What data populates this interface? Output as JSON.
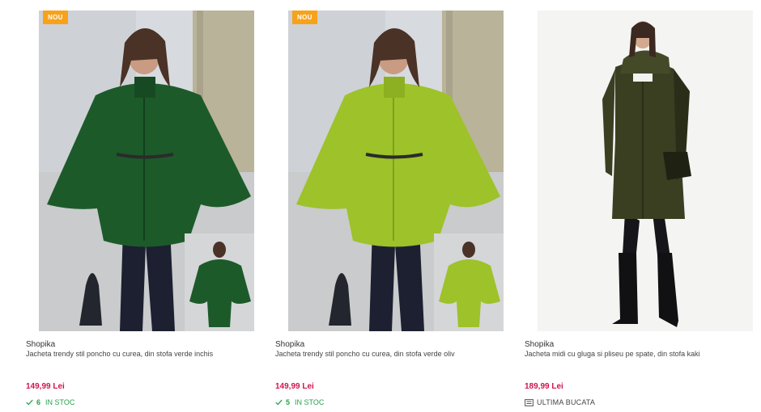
{
  "products": [
    {
      "badge": "NOU",
      "brand": "Shopika",
      "title": "Jacheta trendy stil poncho cu curea, din stofa verde inchis",
      "price": "149,99 Lei",
      "stock_count": "6",
      "stock_label": "IN STOC",
      "coat_color": "#1d5a2a",
      "coat_color_dark": "#123f1c"
    },
    {
      "badge": "NOU",
      "brand": "Shopika",
      "title": "Jacheta trendy stil poncho cu curea, din stofa verde oliv",
      "price": "149,99 Lei",
      "stock_count": "5",
      "stock_label": "IN STOC",
      "coat_color": "#9ec22a",
      "coat_color_dark": "#7fa01c"
    },
    {
      "brand": "Shopika",
      "title": "Jacheta midi cu gluga si pliseu pe spate, din stofa kaki",
      "price": "189,99 Lei",
      "stock_label": "ULTIMA BUCATA",
      "coat_color": "#3a3f22",
      "coat_color_dark": "#2a2e18"
    }
  ],
  "colors": {
    "price": "#d3134d",
    "in_stock": "#27a14a",
    "badge": "#f7a21b"
  },
  "icons": {
    "in_stock": "checkmark-icon",
    "last_piece": "box-icon"
  }
}
